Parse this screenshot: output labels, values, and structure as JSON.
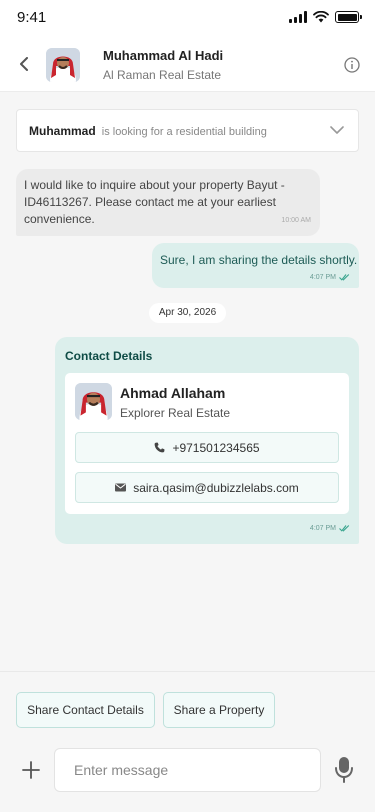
{
  "status_bar": {
    "time": "9:41",
    "icons": [
      "signal-icon",
      "wifi-icon",
      "battery-icon"
    ]
  },
  "header": {
    "name": "Muhammad Al Hadi",
    "company": "Al Raman Real Estate",
    "icons": {
      "back": "chevron-left-icon",
      "info": "info-icon"
    }
  },
  "inquiry": {
    "name": "Muhammad",
    "text": "is looking for a residential building",
    "icon": "chevron-down-icon"
  },
  "messages": {
    "incoming": {
      "text": "I would like to inquire about your property Bayut - ID46113267. Please contact me at your earliest convenience.",
      "time": "10:00 AM"
    },
    "outgoing": {
      "text": "Sure, I am sharing the details shortly.",
      "time": "4:07 PM"
    }
  },
  "date_chip": "Apr 30, 2026",
  "contact_card": {
    "title": "Contact Details",
    "name": "Ahmad Allaham",
    "company": "Explorer Real Estate",
    "phone": "+971501234565",
    "email": "saira.qasim@dubizzlelabs.com",
    "time": "4:07 PM",
    "icons": {
      "phone": "phone-icon",
      "email": "envelope-icon"
    }
  },
  "quick_actions": [
    "Share Contact Details",
    "Share a Property"
  ],
  "composer": {
    "placeholder": "Enter message",
    "icons": {
      "add": "plus-icon",
      "mic": "microphone-icon"
    }
  },
  "colors": {
    "accent": "#0f4c46",
    "outgoing_bubble": "#dcefec",
    "incoming_bubble": "#ebebeb",
    "read_tick": "#3aa58f"
  }
}
